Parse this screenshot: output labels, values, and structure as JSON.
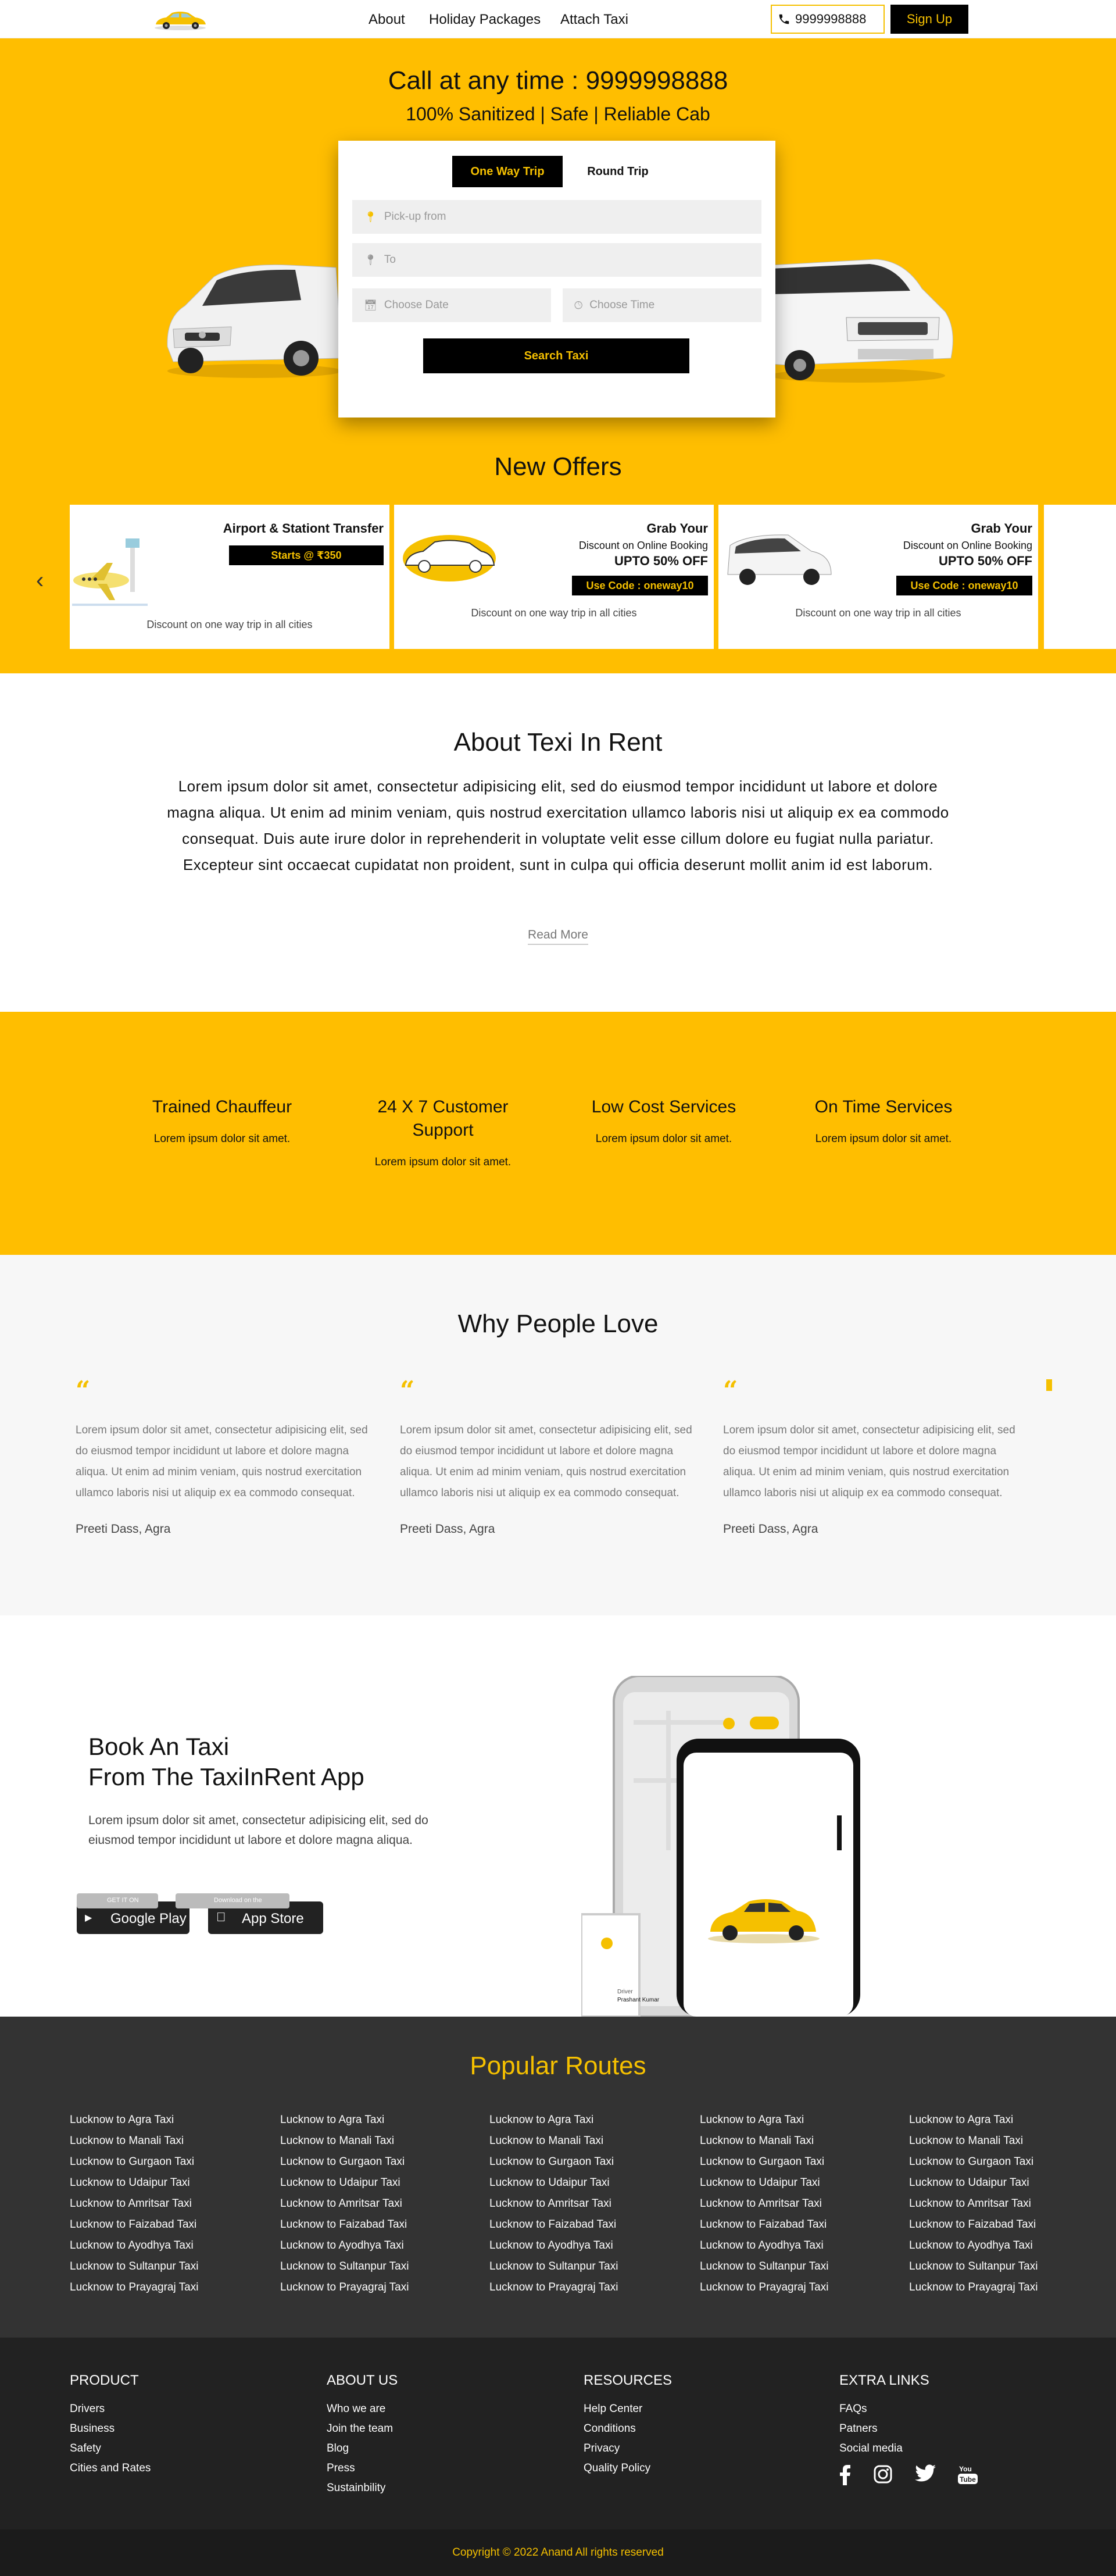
{
  "nav": {
    "links": [
      "About",
      "Holiday Packages",
      "Attach Taxi"
    ],
    "phone": "9999998888",
    "signup_label": "Sign Up"
  },
  "hero": {
    "title": "Call at any time : 9999998888",
    "subtitle": "100% Sanitized | Safe | Reliable Cab"
  },
  "booking": {
    "tabs": [
      "One Way Trip",
      "Round Trip"
    ],
    "active_tab": "One Way Trip",
    "pickup_placeholder": "Pick-up from",
    "to_placeholder": "To",
    "date_placeholder": "Choose Date",
    "time_placeholder": "Choose Time",
    "search_label": "Search Taxi"
  },
  "offers": {
    "title": "New Offers",
    "items": [
      {
        "title": "Airport & Stationt Transfer",
        "badge": "Starts @ ₹350",
        "footer": "Discount on one way trip in all cities"
      },
      {
        "title": "Grab Your",
        "line": "Discount on Online Booking",
        "big": "UPTO 50% OFF",
        "badge": "Use Code : oneway10",
        "footer": "Discount on one way trip in all cities"
      },
      {
        "title": "Grab Your",
        "line": "Discount on Online Booking",
        "big": "UPTO 50% OFF",
        "badge": "Use Code : oneway10",
        "footer": "Discount on one way trip in all cities"
      }
    ]
  },
  "about": {
    "title": "About Texi In Rent",
    "text": "Lorem ipsum dolor sit amet, consectetur adipisicing elit, sed do eiusmod tempor incididunt ut labore et dolore magna aliqua. Ut enim ad minim veniam, quis nostrud exercitation ullamco laboris nisi ut aliquip ex ea commodo consequat. Duis aute irure dolor in reprehenderit in voluptate velit esse cillum dolore eu fugiat nulla pariatur. Excepteur sint occaecat cupidatat non proident, sunt in culpa qui officia deserunt mollit anim id est laborum.",
    "read_more": "Read More"
  },
  "features": [
    {
      "title": "Trained Chauffeur",
      "desc": "Lorem ipsum dolor sit amet."
    },
    {
      "title": "24 X 7 Customer Support",
      "desc": "Lorem ipsum dolor sit amet."
    },
    {
      "title": "Low Cost Services",
      "desc": "Lorem ipsum dolor sit amet."
    },
    {
      "title": "On Time Services",
      "desc": "Lorem ipsum dolor sit amet."
    }
  ],
  "testimonials": {
    "title": "Why People Love",
    "items": [
      {
        "text": "Lorem ipsum dolor sit amet, consectetur adipisicing elit, sed do eiusmod tempor incididunt ut labore et dolore magna aliqua. Ut enim ad minim veniam, quis nostrud exercitation ullamco laboris nisi ut aliquip ex ea commodo consequat.",
        "name": "Preeti Dass, Agra"
      },
      {
        "text": "Lorem ipsum dolor sit amet, consectetur adipisicing elit, sed do eiusmod tempor incididunt ut labore et dolore magna aliqua. Ut enim ad minim veniam, quis nostrud exercitation ullamco laboris nisi ut aliquip ex ea commodo consequat.",
        "name": "Preeti Dass, Agra"
      },
      {
        "text": "Lorem ipsum dolor sit amet, consectetur adipisicing elit, sed do eiusmod tempor incididunt ut labore et dolore magna aliqua. Ut enim ad minim veniam, quis nostrud exercitation ullamco laboris nisi ut aliquip ex ea commodo consequat.",
        "name": "Preeti Dass, Agra"
      }
    ]
  },
  "app": {
    "title_line1": "Book An Taxi",
    "title_line2": "From The TaxiInRent App",
    "text": "Lorem ipsum dolor sit amet, consectetur adipisicing elit, sed do eiusmod tempor incididunt ut labore et dolore magna aliqua.",
    "google_small": "GET IT ON",
    "google_big": "Google Play",
    "apple_small": "Download on the",
    "apple_big": "App Store",
    "phone_driver_label": "Driver",
    "phone_driver_name": "Prashant Kumar"
  },
  "routes": {
    "title": "Popular Routes",
    "items": [
      "Lucknow to Agra Taxi",
      "Lucknow to Manali Taxi",
      "Lucknow to Gurgaon Taxi",
      "Lucknow to Udaipur Taxi",
      "Lucknow to Amritsar Taxi",
      "Lucknow to Faizabad Taxi",
      "Lucknow to Ayodhya Taxi",
      "Lucknow to Sultanpur Taxi",
      "Lucknow to Prayagraj Taxi"
    ]
  },
  "footer": {
    "columns": [
      {
        "title": "PRODUCT",
        "items": [
          "Drivers",
          "Business",
          "Safety",
          "Cities and Rates"
        ]
      },
      {
        "title": "ABOUT US",
        "items": [
          "Who we are",
          "Join the team",
          "Blog",
          "Press",
          "Sustainbility"
        ]
      },
      {
        "title": "RESOURCES",
        "items": [
          "Help Center",
          "Conditions",
          "Privacy",
          "Quality Policy"
        ]
      },
      {
        "title": "EXTRA LINKS",
        "items": [
          "FAQs",
          "Patners",
          "Social media"
        ]
      }
    ],
    "socials": [
      "facebook-icon",
      "instagram-icon",
      "twitter-icon",
      "youtube-icon"
    ],
    "copyright": "Copyright © 2022 Anand All rights reserved"
  },
  "colors": {
    "brand_yellow": "#ffbe00",
    "dark": "#333333",
    "footer": "#222222"
  }
}
